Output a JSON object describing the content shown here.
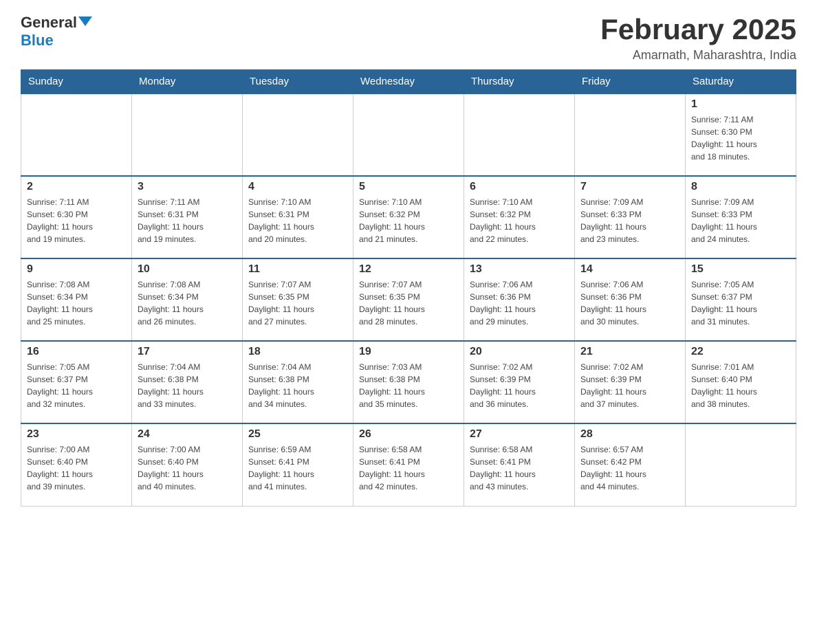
{
  "logo": {
    "general": "General",
    "blue": "Blue"
  },
  "title": "February 2025",
  "location": "Amarnath, Maharashtra, India",
  "weekdays": [
    "Sunday",
    "Monday",
    "Tuesday",
    "Wednesday",
    "Thursday",
    "Friday",
    "Saturday"
  ],
  "weeks": [
    [
      {
        "day": "",
        "info": ""
      },
      {
        "day": "",
        "info": ""
      },
      {
        "day": "",
        "info": ""
      },
      {
        "day": "",
        "info": ""
      },
      {
        "day": "",
        "info": ""
      },
      {
        "day": "",
        "info": ""
      },
      {
        "day": "1",
        "info": "Sunrise: 7:11 AM\nSunset: 6:30 PM\nDaylight: 11 hours\nand 18 minutes."
      }
    ],
    [
      {
        "day": "2",
        "info": "Sunrise: 7:11 AM\nSunset: 6:30 PM\nDaylight: 11 hours\nand 19 minutes."
      },
      {
        "day": "3",
        "info": "Sunrise: 7:11 AM\nSunset: 6:31 PM\nDaylight: 11 hours\nand 19 minutes."
      },
      {
        "day": "4",
        "info": "Sunrise: 7:10 AM\nSunset: 6:31 PM\nDaylight: 11 hours\nand 20 minutes."
      },
      {
        "day": "5",
        "info": "Sunrise: 7:10 AM\nSunset: 6:32 PM\nDaylight: 11 hours\nand 21 minutes."
      },
      {
        "day": "6",
        "info": "Sunrise: 7:10 AM\nSunset: 6:32 PM\nDaylight: 11 hours\nand 22 minutes."
      },
      {
        "day": "7",
        "info": "Sunrise: 7:09 AM\nSunset: 6:33 PM\nDaylight: 11 hours\nand 23 minutes."
      },
      {
        "day": "8",
        "info": "Sunrise: 7:09 AM\nSunset: 6:33 PM\nDaylight: 11 hours\nand 24 minutes."
      }
    ],
    [
      {
        "day": "9",
        "info": "Sunrise: 7:08 AM\nSunset: 6:34 PM\nDaylight: 11 hours\nand 25 minutes."
      },
      {
        "day": "10",
        "info": "Sunrise: 7:08 AM\nSunset: 6:34 PM\nDaylight: 11 hours\nand 26 minutes."
      },
      {
        "day": "11",
        "info": "Sunrise: 7:07 AM\nSunset: 6:35 PM\nDaylight: 11 hours\nand 27 minutes."
      },
      {
        "day": "12",
        "info": "Sunrise: 7:07 AM\nSunset: 6:35 PM\nDaylight: 11 hours\nand 28 minutes."
      },
      {
        "day": "13",
        "info": "Sunrise: 7:06 AM\nSunset: 6:36 PM\nDaylight: 11 hours\nand 29 minutes."
      },
      {
        "day": "14",
        "info": "Sunrise: 7:06 AM\nSunset: 6:36 PM\nDaylight: 11 hours\nand 30 minutes."
      },
      {
        "day": "15",
        "info": "Sunrise: 7:05 AM\nSunset: 6:37 PM\nDaylight: 11 hours\nand 31 minutes."
      }
    ],
    [
      {
        "day": "16",
        "info": "Sunrise: 7:05 AM\nSunset: 6:37 PM\nDaylight: 11 hours\nand 32 minutes."
      },
      {
        "day": "17",
        "info": "Sunrise: 7:04 AM\nSunset: 6:38 PM\nDaylight: 11 hours\nand 33 minutes."
      },
      {
        "day": "18",
        "info": "Sunrise: 7:04 AM\nSunset: 6:38 PM\nDaylight: 11 hours\nand 34 minutes."
      },
      {
        "day": "19",
        "info": "Sunrise: 7:03 AM\nSunset: 6:38 PM\nDaylight: 11 hours\nand 35 minutes."
      },
      {
        "day": "20",
        "info": "Sunrise: 7:02 AM\nSunset: 6:39 PM\nDaylight: 11 hours\nand 36 minutes."
      },
      {
        "day": "21",
        "info": "Sunrise: 7:02 AM\nSunset: 6:39 PM\nDaylight: 11 hours\nand 37 minutes."
      },
      {
        "day": "22",
        "info": "Sunrise: 7:01 AM\nSunset: 6:40 PM\nDaylight: 11 hours\nand 38 minutes."
      }
    ],
    [
      {
        "day": "23",
        "info": "Sunrise: 7:00 AM\nSunset: 6:40 PM\nDaylight: 11 hours\nand 39 minutes."
      },
      {
        "day": "24",
        "info": "Sunrise: 7:00 AM\nSunset: 6:40 PM\nDaylight: 11 hours\nand 40 minutes."
      },
      {
        "day": "25",
        "info": "Sunrise: 6:59 AM\nSunset: 6:41 PM\nDaylight: 11 hours\nand 41 minutes."
      },
      {
        "day": "26",
        "info": "Sunrise: 6:58 AM\nSunset: 6:41 PM\nDaylight: 11 hours\nand 42 minutes."
      },
      {
        "day": "27",
        "info": "Sunrise: 6:58 AM\nSunset: 6:41 PM\nDaylight: 11 hours\nand 43 minutes."
      },
      {
        "day": "28",
        "info": "Sunrise: 6:57 AM\nSunset: 6:42 PM\nDaylight: 11 hours\nand 44 minutes."
      },
      {
        "day": "",
        "info": ""
      }
    ]
  ]
}
